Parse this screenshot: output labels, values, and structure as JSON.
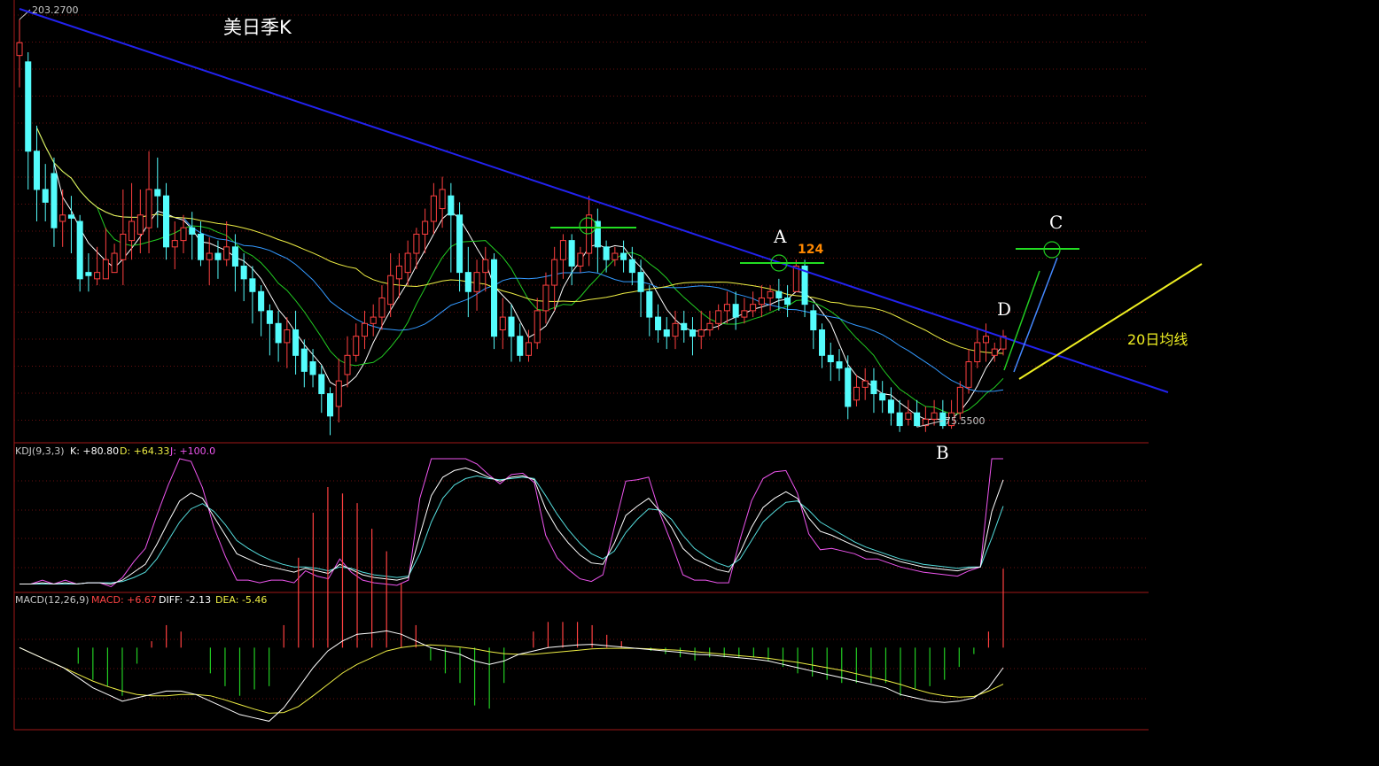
{
  "chart_data": {
    "type": "candlestick",
    "title": "美日季K",
    "price": {
      "high_label": "203.2700",
      "low_label": "75.5500",
      "ylim": [
        72,
        208
      ],
      "candles": [
        [
          192,
          196,
          182,
          203.27
        ],
        [
          190,
          162,
          150,
          193
        ],
        [
          162,
          150,
          140,
          170
        ],
        [
          150,
          146,
          140,
          158
        ],
        [
          155,
          138,
          132,
          160
        ],
        [
          140,
          142,
          132,
          150
        ],
        [
          142,
          141,
          130,
          148
        ],
        [
          140,
          122,
          118,
          142
        ],
        [
          124,
          123,
          118,
          130
        ],
        [
          122,
          124,
          120,
          132
        ],
        [
          122,
          128,
          124,
          138
        ],
        [
          124,
          130,
          124,
          133
        ],
        [
          128,
          136,
          120,
          150
        ],
        [
          134,
          140,
          128,
          152
        ],
        [
          136,
          142,
          130,
          150
        ],
        [
          138,
          150,
          130,
          162
        ],
        [
          150,
          148,
          138,
          160
        ],
        [
          148,
          132,
          128,
          152
        ],
        [
          132,
          134,
          125,
          140
        ],
        [
          134,
          138,
          130,
          142
        ],
        [
          138,
          136,
          128,
          143
        ],
        [
          136,
          128,
          126,
          140
        ],
        [
          128,
          130,
          120,
          135
        ],
        [
          130,
          128,
          122,
          134
        ],
        [
          128,
          132,
          126,
          140
        ],
        [
          132,
          126,
          118,
          136
        ],
        [
          126,
          122,
          115,
          130
        ],
        [
          122,
          118,
          108,
          126
        ],
        [
          118,
          112,
          104,
          120
        ],
        [
          112,
          108,
          98,
          114
        ],
        [
          108,
          102,
          96,
          112
        ],
        [
          102,
          106,
          94,
          110
        ],
        [
          106,
          98,
          92,
          112
        ],
        [
          100,
          93,
          88,
          103
        ],
        [
          96,
          92,
          88,
          100
        ],
        [
          92,
          86,
          80,
          95
        ],
        [
          86,
          79,
          73,
          88
        ],
        [
          82,
          90,
          77,
          97
        ],
        [
          92,
          98,
          88,
          104
        ],
        [
          98,
          104,
          96,
          108
        ],
        [
          104,
          108,
          100,
          112
        ],
        [
          108,
          110,
          104,
          114
        ],
        [
          110,
          116,
          106,
          120
        ],
        [
          114,
          123,
          110,
          130
        ],
        [
          122,
          126,
          116,
          130
        ],
        [
          124,
          130,
          120,
          134
        ],
        [
          130,
          136,
          125,
          138
        ],
        [
          136,
          140,
          130,
          144
        ],
        [
          140,
          148,
          136,
          152
        ],
        [
          144,
          150,
          138,
          154
        ],
        [
          148,
          142,
          124,
          152
        ],
        [
          142,
          124,
          118,
          146
        ],
        [
          124,
          118,
          110,
          132
        ],
        [
          118,
          124,
          112,
          128
        ],
        [
          124,
          128,
          118,
          132
        ],
        [
          128,
          104,
          100,
          130
        ],
        [
          106,
          110,
          100,
          116
        ],
        [
          110,
          104,
          96,
          114
        ],
        [
          104,
          98,
          96,
          108
        ],
        [
          98,
          102,
          96,
          106
        ],
        [
          102,
          112,
          100,
          116
        ],
        [
          112,
          120,
          108,
          124
        ],
        [
          120,
          128,
          112,
          132
        ],
        [
          128,
          134,
          122,
          136
        ],
        [
          134,
          126,
          120,
          136
        ],
        [
          126,
          130,
          124,
          132
        ],
        [
          130,
          142,
          126,
          148
        ],
        [
          140,
          132,
          124,
          144
        ],
        [
          132,
          128,
          124,
          134
        ],
        [
          128,
          130,
          126,
          132
        ],
        [
          130,
          128,
          124,
          134
        ],
        [
          128,
          124,
          120,
          132
        ],
        [
          124,
          118,
          110,
          128
        ],
        [
          118,
          110,
          104,
          120
        ],
        [
          110,
          106,
          102,
          114
        ],
        [
          106,
          104,
          100,
          110
        ],
        [
          104,
          108,
          100,
          112
        ],
        [
          108,
          106,
          102,
          112
        ],
        [
          106,
          104,
          98,
          110
        ],
        [
          104,
          106,
          100,
          112
        ],
        [
          106,
          108,
          104,
          112
        ],
        [
          108,
          112,
          106,
          114
        ],
        [
          112,
          114,
          108,
          118
        ],
        [
          114,
          110,
          106,
          118
        ],
        [
          110,
          112,
          108,
          116
        ],
        [
          112,
          114,
          110,
          118
        ],
        [
          114,
          116,
          110,
          120
        ],
        [
          116,
          118,
          112,
          120
        ],
        [
          118,
          116,
          112,
          122
        ],
        [
          116,
          114,
          110,
          120
        ],
        [
          118,
          126,
          120,
          128
        ],
        [
          126,
          114,
          110,
          128
        ],
        [
          112,
          106,
          100,
          114
        ],
        [
          106,
          98,
          94,
          108
        ],
        [
          98,
          96,
          90,
          102
        ],
        [
          96,
          94,
          90,
          100
        ],
        [
          94,
          82,
          78,
          98
        ],
        [
          84,
          88,
          82,
          92
        ],
        [
          88,
          90,
          84,
          94
        ],
        [
          90,
          86,
          80,
          94
        ],
        [
          86,
          84,
          80,
          90
        ],
        [
          84,
          80,
          76,
          88
        ],
        [
          80,
          76,
          74,
          84
        ],
        [
          78,
          80,
          76,
          84
        ],
        [
          80,
          76,
          75.55,
          84
        ],
        [
          76,
          78,
          74,
          82
        ],
        [
          78,
          80,
          76,
          84
        ],
        [
          80,
          76,
          75,
          84
        ],
        [
          76,
          80,
          75,
          84
        ],
        [
          80,
          88,
          78,
          90
        ],
        [
          88,
          96,
          86,
          100
        ],
        [
          96,
          102,
          94,
          106
        ],
        [
          102,
          104,
          96,
          108
        ],
        [
          98,
          100,
          96,
          102
        ],
        [
          100,
          104,
          98,
          106
        ]
      ]
    },
    "kdj": {
      "label": "KDJ(9,3,3)",
      "K_label": "K: +80.80",
      "D_label": "D: +64.33",
      "J_label": "J: +100.0",
      "ylim": [
        0,
        100
      ],
      "K": [
        5,
        5,
        6,
        5,
        6,
        5,
        6,
        6,
        5,
        8,
        14,
        20,
        35,
        52,
        68,
        74,
        70,
        56,
        42,
        28,
        24,
        20,
        18,
        16,
        14,
        17,
        15,
        13,
        20,
        16,
        12,
        10,
        9,
        8,
        10,
        42,
        72,
        86,
        91,
        93,
        90,
        86,
        83,
        86,
        87,
        84,
        62,
        47,
        36,
        27,
        21,
        20,
        36,
        57,
        64,
        70,
        60,
        48,
        32,
        24,
        20,
        16,
        14,
        29,
        48,
        63,
        70,
        75,
        70,
        55,
        45,
        42,
        38,
        34,
        30,
        28,
        25,
        22,
        20,
        18,
        17,
        16,
        15,
        17,
        18,
        60,
        84
      ],
      "D": [
        5,
        5,
        5,
        5,
        5,
        5,
        6,
        6,
        6,
        7,
        10,
        14,
        24,
        38,
        52,
        62,
        66,
        60,
        50,
        38,
        32,
        27,
        23,
        20,
        18,
        18,
        17,
        15,
        18,
        17,
        14,
        12,
        11,
        10,
        11,
        28,
        52,
        70,
        80,
        85,
        87,
        85,
        84,
        85,
        86,
        85,
        72,
        58,
        46,
        36,
        28,
        24,
        30,
        44,
        54,
        62,
        61,
        54,
        42,
        32,
        26,
        21,
        18,
        24,
        38,
        52,
        60,
        67,
        68,
        61,
        52,
        47,
        42,
        37,
        33,
        30,
        27,
        24,
        22,
        20,
        19,
        18,
        17,
        18,
        18,
        40,
        64
      ],
      "J": [
        5,
        5,
        8,
        5,
        8,
        5,
        6,
        6,
        3,
        10,
        22,
        32,
        57,
        80,
        100,
        98,
        78,
        48,
        26,
        8,
        8,
        6,
        8,
        8,
        6,
        15,
        11,
        9,
        24,
        14,
        8,
        6,
        5,
        4,
        8,
        70,
        100,
        100,
        100,
        100,
        96,
        88,
        81,
        88,
        89,
        82,
        42,
        25,
        16,
        9,
        7,
        12,
        48,
        83,
        84,
        86,
        58,
        36,
        12,
        8,
        8,
        6,
        6,
        39,
        68,
        85,
        90,
        91,
        74,
        43,
        31,
        32,
        30,
        28,
        24,
        24,
        21,
        18,
        16,
        14,
        13,
        12,
        11,
        15,
        18,
        100,
        100
      ]
    },
    "macd": {
      "label": "MACD(12,26,9)",
      "MACD_label": "MACD: +6.67",
      "DIFF_label": "DIFF: -2.13",
      "DEA_label": "DEA: -5.46",
      "ylim": [
        -12,
        6
      ],
      "DIFF": [
        0,
        -1,
        -2,
        -3,
        -4.5,
        -6,
        -7,
        -8,
        -7.5,
        -7,
        -6.5,
        -6.5,
        -7,
        -8,
        -9,
        -10,
        -10.5,
        -11,
        -9,
        -6,
        -3,
        -0.5,
        1,
        2,
        2.2,
        2.5,
        2,
        1,
        0,
        -0.5,
        -1,
        -2,
        -2.5,
        -2,
        -1,
        -0.5,
        0,
        0.2,
        0.4,
        0.5,
        0.3,
        0.1,
        -0.1,
        -0.3,
        -0.5,
        -0.7,
        -1,
        -1.1,
        -1.3,
        -1.5,
        -1.7,
        -2,
        -2.5,
        -3,
        -3.5,
        -4,
        -4.5,
        -5,
        -5.5,
        -6,
        -7,
        -7.5,
        -8,
        -8.2,
        -8,
        -7.5,
        -6,
        -3
      ],
      "DEA": [
        0,
        -1,
        -2,
        -3,
        -4,
        -5,
        -5.8,
        -6.5,
        -7,
        -7.2,
        -7.2,
        -7,
        -7,
        -7.2,
        -7.8,
        -8.5,
        -9.2,
        -9.8,
        -9.7,
        -8.8,
        -7.2,
        -5.5,
        -3.8,
        -2.5,
        -1.5,
        -0.5,
        0,
        0.3,
        0.4,
        0.3,
        0.1,
        -0.2,
        -0.6,
        -0.9,
        -1,
        -1,
        -0.8,
        -0.6,
        -0.4,
        -0.2,
        -0.1,
        -0.1,
        -0.1,
        -0.2,
        -0.3,
        -0.4,
        -0.6,
        -0.8,
        -1,
        -1.2,
        -1.4,
        -1.6,
        -1.9,
        -2.2,
        -2.6,
        -3,
        -3.4,
        -3.9,
        -4.4,
        -4.9,
        -5.5,
        -6.2,
        -6.8,
        -7.2,
        -7.4,
        -7.3,
        -6.5,
        -5.46
      ]
    },
    "annotations": {
      "A": "A",
      "B": "B",
      "C": "C",
      "D": "D",
      "level": "124",
      "ma_note": "20日均线"
    }
  }
}
